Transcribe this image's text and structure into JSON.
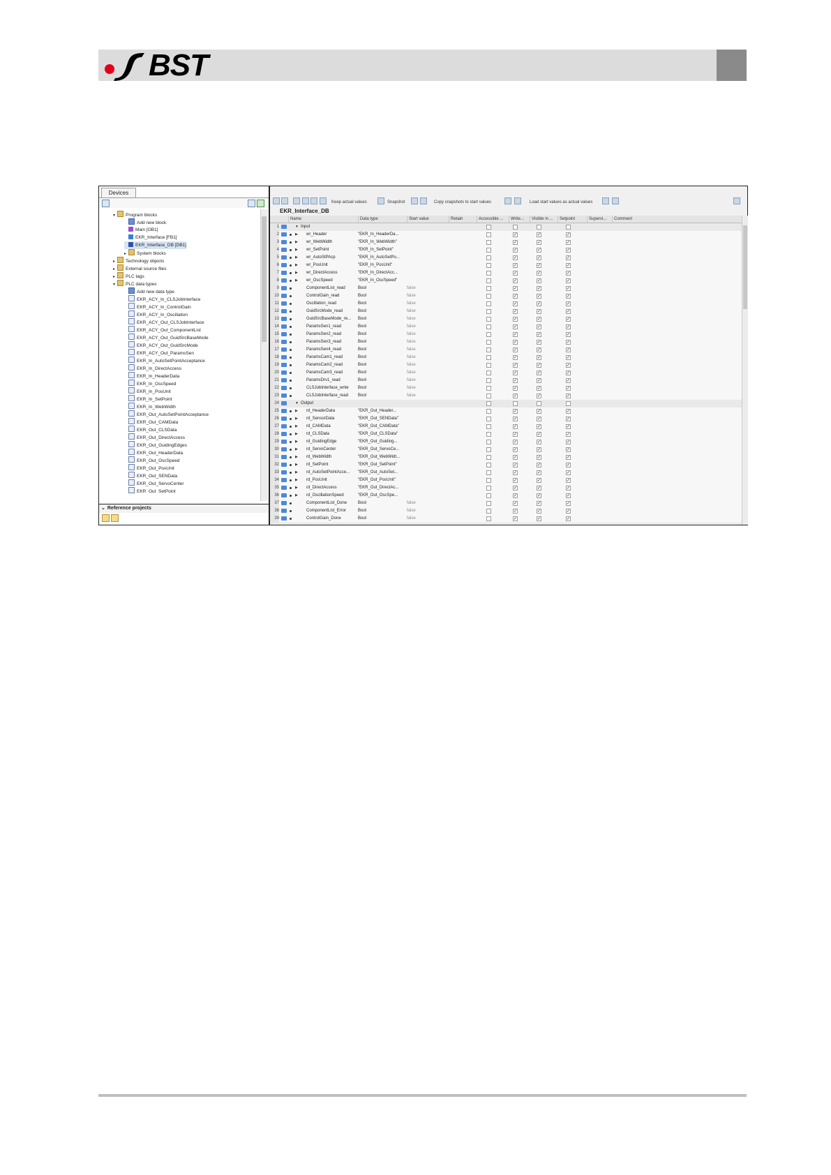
{
  "logo": {
    "text": "BST",
    "swoosh_color": "#e2001a"
  },
  "tree": {
    "tab": "Devices",
    "reference_label": "Reference projects",
    "items": [
      {
        "label": "Program blocks",
        "level": 0,
        "arrow": "▾",
        "icon": "folder"
      },
      {
        "label": "Add new block",
        "level": 1,
        "arrow": "",
        "icon": "add"
      },
      {
        "label": "Main [OB1]",
        "level": 1,
        "arrow": "",
        "icon": "ob"
      },
      {
        "label": "EKR_Interface [FB1]",
        "level": 1,
        "arrow": "",
        "icon": "fb"
      },
      {
        "label": "EKR_Interface_DB [DB1]",
        "level": 1,
        "arrow": "",
        "icon": "db",
        "selected": true
      },
      {
        "label": "System blocks",
        "level": 1,
        "arrow": "▸",
        "icon": "folder"
      },
      {
        "label": "Technology objects",
        "level": 0,
        "arrow": "▸",
        "icon": "folder"
      },
      {
        "label": "External source files",
        "level": 0,
        "arrow": "▸",
        "icon": "folder"
      },
      {
        "label": "PLC tags",
        "level": 0,
        "arrow": "▸",
        "icon": "folder"
      },
      {
        "label": "PLC data types",
        "level": 0,
        "arrow": "▾",
        "icon": "folder"
      },
      {
        "label": "Add new data type",
        "level": 1,
        "arrow": "",
        "icon": "add"
      },
      {
        "label": "EKR_ACY_In_CLSJobInterface",
        "level": 1,
        "arrow": "",
        "icon": "type"
      },
      {
        "label": "EKR_ACY_In_ControlGain",
        "level": 1,
        "arrow": "",
        "icon": "type"
      },
      {
        "label": "EKR_ACY_In_Oscillation",
        "level": 1,
        "arrow": "",
        "icon": "type"
      },
      {
        "label": "EKR_ACY_Out_CLSJobInterface",
        "level": 1,
        "arrow": "",
        "icon": "type"
      },
      {
        "label": "EKR_ACY_Out_ComponentList",
        "level": 1,
        "arrow": "",
        "icon": "type"
      },
      {
        "label": "EKR_ACY_Out_GuidSrcBaseMode",
        "level": 1,
        "arrow": "",
        "icon": "type"
      },
      {
        "label": "EKR_ACY_Out_GuidSrcMode",
        "level": 1,
        "arrow": "",
        "icon": "type"
      },
      {
        "label": "EKR_ACY_Out_ParamsSen",
        "level": 1,
        "arrow": "",
        "icon": "type"
      },
      {
        "label": "EKR_In_AutoSetPointAcceptance",
        "level": 1,
        "arrow": "",
        "icon": "type"
      },
      {
        "label": "EKR_In_DirectAccess",
        "level": 1,
        "arrow": "",
        "icon": "type"
      },
      {
        "label": "EKR_In_HeaderData",
        "level": 1,
        "arrow": "",
        "icon": "type"
      },
      {
        "label": "EKR_In_OscSpeed",
        "level": 1,
        "arrow": "",
        "icon": "type"
      },
      {
        "label": "EKR_In_PosUnit",
        "level": 1,
        "arrow": "",
        "icon": "type"
      },
      {
        "label": "EKR_In_SetPoint",
        "level": 1,
        "arrow": "",
        "icon": "type"
      },
      {
        "label": "EKR_In_WebWidth",
        "level": 1,
        "arrow": "",
        "icon": "type"
      },
      {
        "label": "EKR_Out_AutoSetPointAcceptance",
        "level": 1,
        "arrow": "",
        "icon": "type"
      },
      {
        "label": "EKR_Out_CAMData",
        "level": 1,
        "arrow": "",
        "icon": "type"
      },
      {
        "label": "EKR_Out_CLSData",
        "level": 1,
        "arrow": "",
        "icon": "type"
      },
      {
        "label": "EKR_Out_DirectAccess",
        "level": 1,
        "arrow": "",
        "icon": "type"
      },
      {
        "label": "EKR_Out_GuidingEdges",
        "level": 1,
        "arrow": "",
        "icon": "type"
      },
      {
        "label": "EKR_Out_HeaderData",
        "level": 1,
        "arrow": "",
        "icon": "type"
      },
      {
        "label": "EKR_Out_OscSpeed",
        "level": 1,
        "arrow": "",
        "icon": "type"
      },
      {
        "label": "EKR_Out_PosUnit",
        "level": 1,
        "arrow": "",
        "icon": "type"
      },
      {
        "label": "EKR_Out_SENData",
        "level": 1,
        "arrow": "",
        "icon": "type"
      },
      {
        "label": "EKR_Out_ServoCenter",
        "level": 1,
        "arrow": "",
        "icon": "type"
      },
      {
        "label": "EKR_Out_SetPoint",
        "level": 1,
        "arrow": "",
        "icon": "type"
      }
    ]
  },
  "editor": {
    "toolbar": {
      "keep": "Keep actual values",
      "snapshot": "Snapshot",
      "copy": "Copy snapshots to start values",
      "load": "Load start values as actual values"
    },
    "title": "EKR_Interface_DB",
    "columns": [
      "Name",
      "Data type",
      "Start value",
      "Retain",
      "Accessible ...",
      "Write...",
      "Visible in ...",
      "Setpoint",
      "Supervi...",
      "Comment"
    ],
    "rows": [
      {
        "n": "1",
        "name": "Input",
        "type": "",
        "start": "",
        "group": true
      },
      {
        "n": "2",
        "name": "wr_Header",
        "type": "\"EKR_In_HeaderDa...",
        "start": "",
        "sub": true
      },
      {
        "n": "3",
        "name": "wr_WebWidth",
        "type": "\"EKR_In_WebWidth\"",
        "start": "",
        "sub": true
      },
      {
        "n": "4",
        "name": "wr_SetPoint",
        "type": "\"EKR_In_SetPoint\"",
        "start": "",
        "sub": true
      },
      {
        "n": "5",
        "name": "wr_AutoStPAcp",
        "type": "\"EKR_In_AutoSetPo...",
        "start": "",
        "sub": true
      },
      {
        "n": "6",
        "name": "wr_PosUnit",
        "type": "\"EKR_In_PosUnit\"",
        "start": "",
        "sub": true
      },
      {
        "n": "7",
        "name": "wr_DirectAccess",
        "type": "\"EKR_In_DirectAcc...",
        "start": "",
        "sub": true
      },
      {
        "n": "8",
        "name": "wr_OscSpeed",
        "type": "\"EKR_In_OscSpeed\"",
        "start": "",
        "sub": true
      },
      {
        "n": "9",
        "name": "ComponentList_read",
        "type": "Bool",
        "start": "false"
      },
      {
        "n": "10",
        "name": "ControlGain_read",
        "type": "Bool",
        "start": "false"
      },
      {
        "n": "11",
        "name": "Oscillation_read",
        "type": "Bool",
        "start": "false"
      },
      {
        "n": "12",
        "name": "GuidSrcMode_read",
        "type": "Bool",
        "start": "false"
      },
      {
        "n": "13",
        "name": "GuidSrcBaseMode_re...",
        "type": "Bool",
        "start": "false"
      },
      {
        "n": "14",
        "name": "ParamsSen1_read",
        "type": "Bool",
        "start": "false"
      },
      {
        "n": "15",
        "name": "ParamsSen2_read",
        "type": "Bool",
        "start": "false"
      },
      {
        "n": "16",
        "name": "ParamsSen3_read",
        "type": "Bool",
        "start": "false"
      },
      {
        "n": "17",
        "name": "ParamsSen4_read",
        "type": "Bool",
        "start": "false"
      },
      {
        "n": "18",
        "name": "ParamsCam1_read",
        "type": "Bool",
        "start": "false"
      },
      {
        "n": "19",
        "name": "ParamsCam2_read",
        "type": "Bool",
        "start": "false"
      },
      {
        "n": "20",
        "name": "ParamsCam3_read",
        "type": "Bool",
        "start": "false"
      },
      {
        "n": "21",
        "name": "ParamsDrv1_read",
        "type": "Bool",
        "start": "false"
      },
      {
        "n": "22",
        "name": "CLSJobInterface_write",
        "type": "Bool",
        "start": "false"
      },
      {
        "n": "23",
        "name": "CLSJobInterface_read",
        "type": "Bool",
        "start": "false"
      },
      {
        "n": "24",
        "name": "Output",
        "type": "",
        "start": "",
        "group": true
      },
      {
        "n": "25",
        "name": "rd_HeaderData",
        "type": "\"EKR_Out_Header...",
        "start": "",
        "sub": true
      },
      {
        "n": "26",
        "name": "rd_SensorData",
        "type": "\"EKR_Out_SENData\"",
        "start": "",
        "sub": true
      },
      {
        "n": "27",
        "name": "rd_CAMData",
        "type": "\"EKR_Out_CAMData\"",
        "start": "",
        "sub": true
      },
      {
        "n": "28",
        "name": "rd_CLSData",
        "type": "\"EKR_Out_CLSData\"",
        "start": "",
        "sub": true
      },
      {
        "n": "29",
        "name": "rd_GuidingEdge",
        "type": "\"EKR_Out_Guiding...",
        "start": "",
        "sub": true
      },
      {
        "n": "30",
        "name": "rd_ServoCenter",
        "type": "\"EKR_Out_ServoCe...",
        "start": "",
        "sub": true
      },
      {
        "n": "31",
        "name": "rd_WebWidth",
        "type": "\"EKR_Out_WebWidt...",
        "start": "",
        "sub": true
      },
      {
        "n": "32",
        "name": "rd_SetPoint",
        "type": "\"EKR_Out_SetPoint\"",
        "start": "",
        "sub": true
      },
      {
        "n": "33",
        "name": "rd_AutoSetPointAcce...",
        "type": "\"EKR_Out_AutoSet...",
        "start": "",
        "sub": true
      },
      {
        "n": "34",
        "name": "rd_PosUnit",
        "type": "\"EKR_Out_PosUnit\"",
        "start": "",
        "sub": true
      },
      {
        "n": "35",
        "name": "rd_DirectAccess",
        "type": "\"EKR_Out_DirectAc...",
        "start": "",
        "sub": true
      },
      {
        "n": "36",
        "name": "rd_OscillationSpeed",
        "type": "\"EKR_Out_OscSpe...",
        "start": "",
        "sub": true
      },
      {
        "n": "37",
        "name": "ComponentList_Done",
        "type": "Bool",
        "start": "false"
      },
      {
        "n": "38",
        "name": "ComponentList_Error",
        "type": "Bool",
        "start": "false"
      },
      {
        "n": "39",
        "name": "ControlGain_Done",
        "type": "Bool",
        "start": "false"
      }
    ]
  }
}
